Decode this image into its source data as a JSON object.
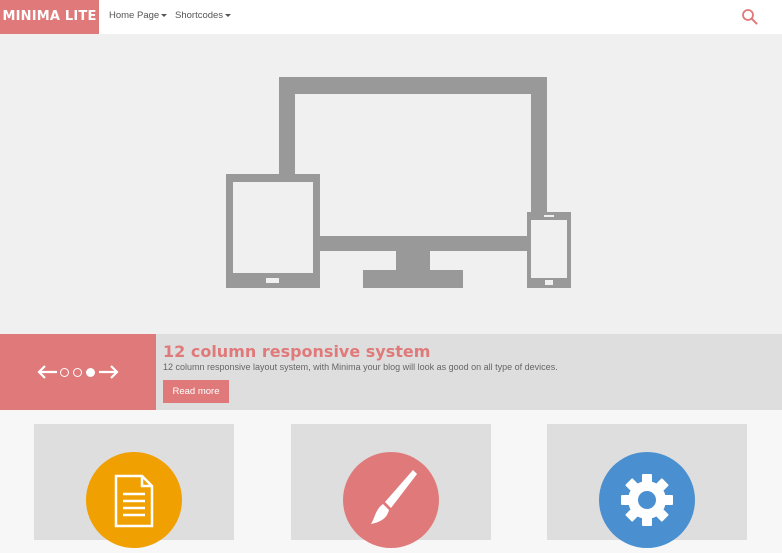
{
  "header": {
    "logo": "MINIMA LITE",
    "nav": [
      {
        "label": "Home Page"
      },
      {
        "label": "Shortcodes"
      }
    ],
    "search_icon": "search-icon"
  },
  "hero": {
    "illustration": [
      "desktop-monitor-icon",
      "tablet-icon",
      "phone-icon"
    ],
    "color": "#999999"
  },
  "slider": {
    "title": "12 column responsive system",
    "text": "12 column responsive layout system, with Minima your blog will look as good on all type of devices.",
    "button": "Read more",
    "slide_count": 3,
    "active_slide": 3
  },
  "features": [
    {
      "icon": "document-icon",
      "color": "#f0a000"
    },
    {
      "icon": "paintbrush-icon",
      "color": "#e07a7a"
    },
    {
      "icon": "gear-icon",
      "color": "#4a90d0"
    }
  ],
  "colors": {
    "accent": "#e07a7a"
  }
}
